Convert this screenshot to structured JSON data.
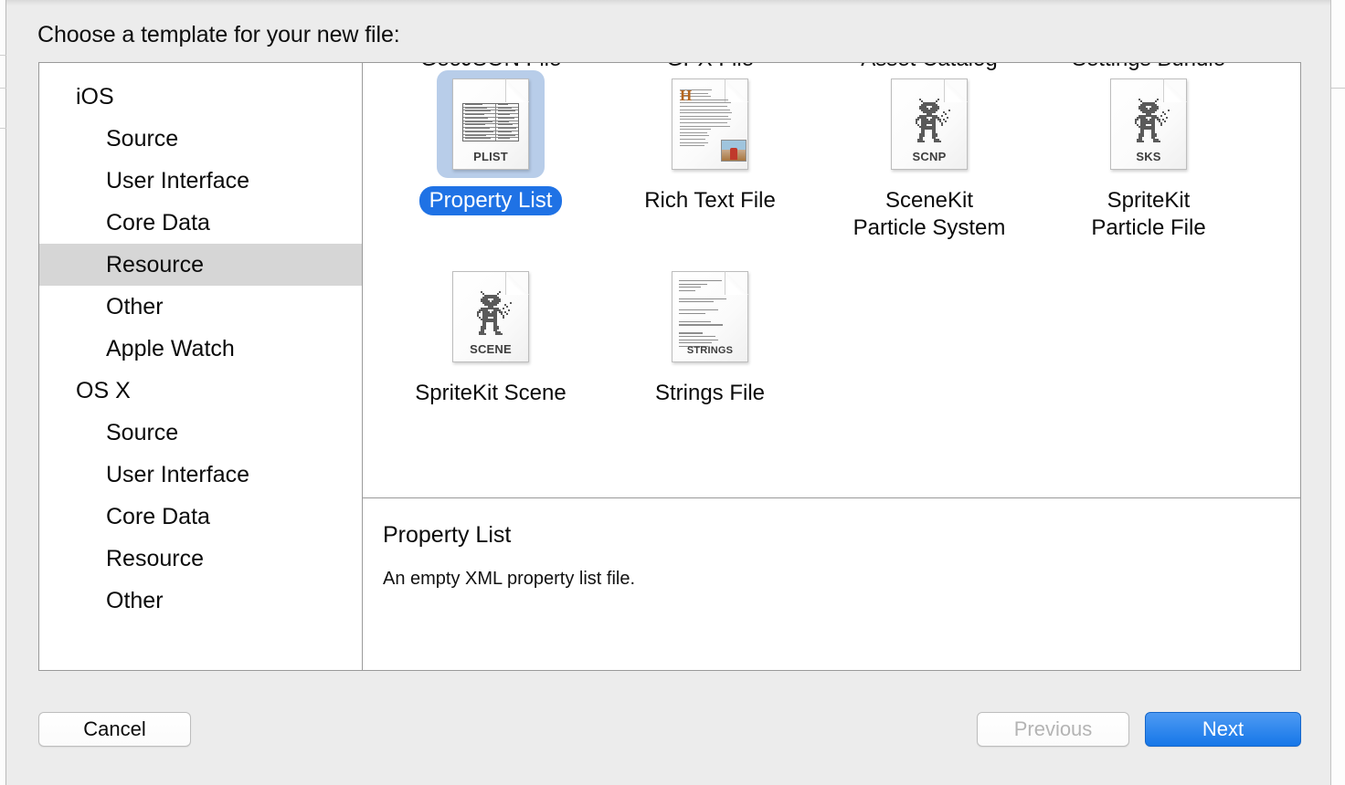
{
  "dialog": {
    "title": "Choose a template for your new file:"
  },
  "sidebar": {
    "items": [
      {
        "label": "iOS",
        "level": "group",
        "selected": false
      },
      {
        "label": "Source",
        "level": "child",
        "selected": false
      },
      {
        "label": "User Interface",
        "level": "child",
        "selected": false
      },
      {
        "label": "Core Data",
        "level": "child",
        "selected": false
      },
      {
        "label": "Resource",
        "level": "child",
        "selected": true
      },
      {
        "label": "Other",
        "level": "child",
        "selected": false
      },
      {
        "label": "Apple Watch",
        "level": "child",
        "selected": false
      },
      {
        "label": "OS X",
        "level": "group",
        "selected": false
      },
      {
        "label": "Source",
        "level": "child",
        "selected": false
      },
      {
        "label": "User Interface",
        "level": "child",
        "selected": false
      },
      {
        "label": "Core Data",
        "level": "child",
        "selected": false
      },
      {
        "label": "Resource",
        "level": "child",
        "selected": false
      },
      {
        "label": "Other",
        "level": "child",
        "selected": false
      }
    ]
  },
  "templates": {
    "clipped_row": [
      {
        "label": "GeoJSON File"
      },
      {
        "label": "GPX File"
      },
      {
        "label": "Asset Catalog"
      },
      {
        "label": "Settings Bundle"
      }
    ],
    "items": [
      {
        "label": "Property List",
        "icon": "plist-file-icon",
        "tag": "PLIST",
        "selected": true
      },
      {
        "label": "Rich Text File",
        "icon": "rich-text-file-icon",
        "tag": "",
        "selected": false
      },
      {
        "label": "SceneKit\nParticle System",
        "icon": "scenekit-particle-file-icon",
        "tag": "SCNP",
        "selected": false
      },
      {
        "label": "SpriteKit\nParticle File",
        "icon": "spritekit-particle-file-icon",
        "tag": "SKS",
        "selected": false
      },
      {
        "label": "SpriteKit Scene",
        "icon": "spritekit-scene-file-icon",
        "tag": "SCENE",
        "selected": false
      },
      {
        "label": "Strings File",
        "icon": "strings-file-icon",
        "tag": "STRINGS",
        "selected": false
      }
    ]
  },
  "description": {
    "title": "Property List",
    "text": "An empty XML property list file."
  },
  "footer": {
    "cancel_label": "Cancel",
    "previous_label": "Previous",
    "next_label": "Next"
  },
  "colors": {
    "selection_blue": "#1f72e5",
    "icon_selection_bg": "#b8cde9",
    "sidebar_selection": "#d6d6d6",
    "default_button_blue": "#1677e8",
    "window_bg": "#ececec"
  }
}
